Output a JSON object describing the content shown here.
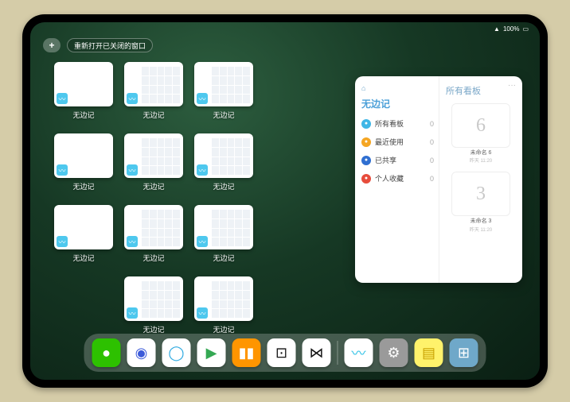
{
  "status": {
    "battery": "100%",
    "wifi": "●"
  },
  "topbar": {
    "plus": "+",
    "reopen_label": "重新打开已关闭的窗口"
  },
  "window_grid": {
    "app_label": "无边记",
    "items": [
      {
        "blank": true
      },
      {
        "blank": false
      },
      {
        "blank": false
      },
      null,
      {
        "blank": true
      },
      {
        "blank": false
      },
      {
        "blank": false
      },
      null,
      {
        "blank": true
      },
      {
        "blank": false
      },
      {
        "blank": false
      },
      null,
      null,
      {
        "blank": false
      },
      {
        "blank": false
      },
      null
    ]
  },
  "panel": {
    "logo": "⌂",
    "title": "无边记",
    "more": "···",
    "items": [
      {
        "label": "所有看板",
        "count": 0,
        "color": "#3fb6e6"
      },
      {
        "label": "最近使用",
        "count": 0,
        "color": "#f5a623"
      },
      {
        "label": "已共享",
        "count": 0,
        "color": "#2f6fd1"
      },
      {
        "label": "个人收藏",
        "count": 0,
        "color": "#e74c3c"
      }
    ],
    "right_title": "所有看板",
    "cards": [
      {
        "glyph": "6",
        "title": "未命名 6",
        "sub": "昨天 11:20"
      },
      {
        "glyph": "3",
        "title": "未命名 3",
        "sub": "昨天 11:20"
      }
    ]
  },
  "dock": {
    "apps": [
      {
        "name": "wechat",
        "bg": "#2dc100",
        "glyph": "●"
      },
      {
        "name": "quark",
        "bg": "#ffffff",
        "glyph": "◉",
        "fg": "#3c5bd9"
      },
      {
        "name": "browser",
        "bg": "#ffffff",
        "glyph": "◯",
        "fg": "#2aa8e0"
      },
      {
        "name": "play",
        "bg": "#ffffff",
        "glyph": "▶",
        "fg": "#34a853"
      },
      {
        "name": "books",
        "bg": "#ff9500",
        "glyph": "▮▮"
      },
      {
        "name": "dice",
        "bg": "#ffffff",
        "glyph": "⊡",
        "fg": "#111"
      },
      {
        "name": "graph",
        "bg": "#ffffff",
        "glyph": "⋈",
        "fg": "#111"
      }
    ],
    "recents": [
      {
        "name": "freeform",
        "bg": "#ffffff",
        "glyph": "〰",
        "fg": "#29c0e6"
      },
      {
        "name": "settings",
        "bg": "#9a9a9a",
        "glyph": "⚙"
      },
      {
        "name": "notes",
        "bg": "#fff26b",
        "glyph": "▤",
        "fg": "#c9a100"
      },
      {
        "name": "app-library",
        "bg": "#6fa8c9",
        "glyph": "⊞"
      }
    ]
  }
}
